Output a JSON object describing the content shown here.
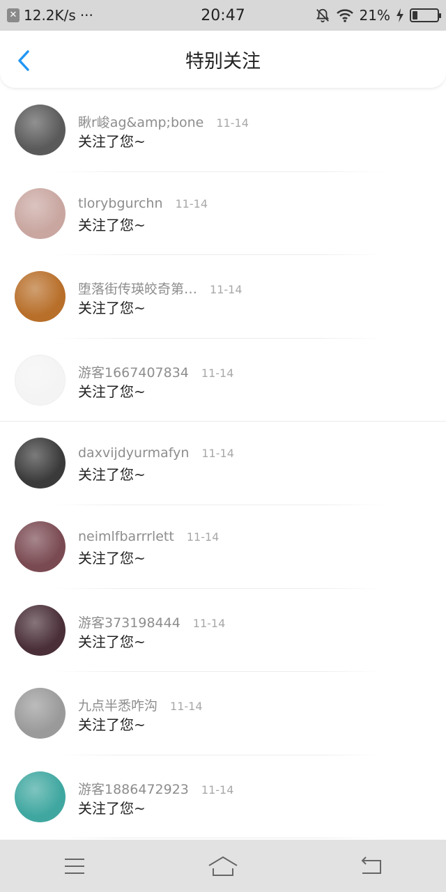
{
  "status_bar": {
    "network_speed": "12.2K/s",
    "more": "···",
    "time": "20:47",
    "battery_percent": "21%",
    "battery_level": 0.21
  },
  "header": {
    "title": "特别关注"
  },
  "list": {
    "items": [
      {
        "name": "瞅r峻ag&amp;bone",
        "date": "11-14",
        "message": "关注了您~",
        "avatar_color": "#5a5a5a"
      },
      {
        "name": "tlorybgurchn",
        "date": "11-14",
        "message": "关注了您~",
        "avatar_color": "#c9a6a0"
      },
      {
        "name": "堕落街传瑛皎奇第…",
        "date": "11-14",
        "message": "关注了您~",
        "avatar_color": "#b86f2a"
      },
      {
        "name": "游客1667407834",
        "date": "11-14",
        "message": "关注了您~",
        "avatar_color": "#f4f4f4"
      },
      {
        "name": "daxvijdyurmafyn",
        "date": "11-14",
        "message": "关注了您~",
        "avatar_color": "#3a3a3a"
      },
      {
        "name": "neimlfbarrrlett",
        "date": "11-14",
        "message": "关注了您~",
        "avatar_color": "#7a4a52"
      },
      {
        "name": "游客373198444",
        "date": "11-14",
        "message": "关注了您~",
        "avatar_color": "#4a2f38"
      },
      {
        "name": "九点半悉咋沟",
        "date": "11-14",
        "message": "关注了您~",
        "avatar_color": "#9a9a9a"
      },
      {
        "name": "游客1886472923",
        "date": "11-14",
        "message": "关注了您~",
        "avatar_color": "#3fa7a0"
      }
    ]
  },
  "icons": {
    "back": "back-chevron-icon",
    "menu": "menu-icon",
    "home": "home-icon",
    "return": "return-icon"
  },
  "colors": {
    "accent": "#2196f3",
    "status_bar_bg": "#d8d8d8",
    "nav_bar_bg": "#e2e2e2"
  }
}
